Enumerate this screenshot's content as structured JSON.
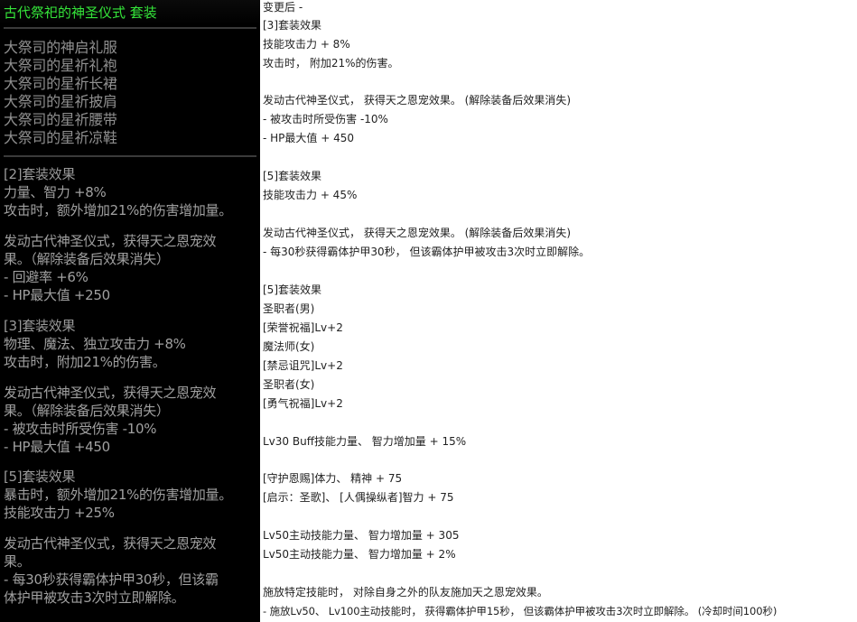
{
  "tooltip": {
    "title": "古代祭祀的神圣仪式  套装",
    "items": [
      "大祭司的神启礼服",
      "大祭司的星祈礼袍",
      "大祭司的星祈长裙",
      "大祭司的星祈披肩",
      "大祭司的星祈腰带",
      "大祭司的星祈凉鞋"
    ],
    "lines": [
      "[2]套装效果",
      "力量、智力 +8%",
      "攻击时，额外增加21%的伤害增加量。",
      "发动古代神圣仪式，获得天之恩宠效",
      "果。（解除装备后效果消失）",
      "- 回避率 +6%",
      "- HP最大值 +250",
      "[3]套装效果",
      "物理、魔法、独立攻击力 +8%",
      "攻击时，附加21%的伤害。",
      "发动古代神圣仪式，获得天之恩宠效",
      "果。（解除装备后效果消失）",
      "- 被攻击时所受伤害 -10%",
      "- HP最大值 +450",
      "[5]套装效果",
      "暴击时，额外增加21%的伤害增加量。",
      "技能攻击力 +25%",
      "发动古代神圣仪式，获得天之恩宠效",
      "果。",
      "- 每30秒获得霸体护甲30秒，但该霸",
      "体护甲被攻击3次时立即解除。"
    ]
  },
  "notes": {
    "lines": [
      "变更后 -",
      "[3]套装效果",
      "技能攻击力 + 8%",
      "攻击时， 附加21%的伤害。",
      "发动古代神圣仪式， 获得天之恩宠效果。 (解除装备后效果消失)",
      "- 被攻击时所受伤害 -10%",
      "- HP最大值 + 450",
      "[5]套装效果",
      "技能攻击力 + 45%",
      "发动古代神圣仪式， 获得天之恩宠效果。 (解除装备后效果消失)",
      "- 每30秒获得霸体护甲30秒， 但该霸体护甲被攻击3次时立即解除。",
      "[5]套装效果",
      "圣职者(男)",
      "[荣誉祝福]Lv+2",
      "魔法师(女)",
      "[禁忌诅咒]Lv+2",
      "圣职者(女)",
      "[勇气祝福]Lv+2",
      "Lv30 Buff技能力量、 智力增加量 + 15%",
      "[守护恩赐]体力、 精神 + 75",
      "[启示：圣歌]、 [人偶操纵者]智力 + 75",
      "Lv50主动技能力量、 智力增加量 + 305",
      "Lv50主动技能力量、 智力增加量 + 2%",
      "施放特定技能时， 对除自身之外的队友施加天之恩宠效果。",
      "- 施放Lv50、 Lv100主动技能时， 获得霸体护甲15秒， 但该霸体护甲被攻击3次时立即解除。 (冷却时间100秒)"
    ]
  }
}
